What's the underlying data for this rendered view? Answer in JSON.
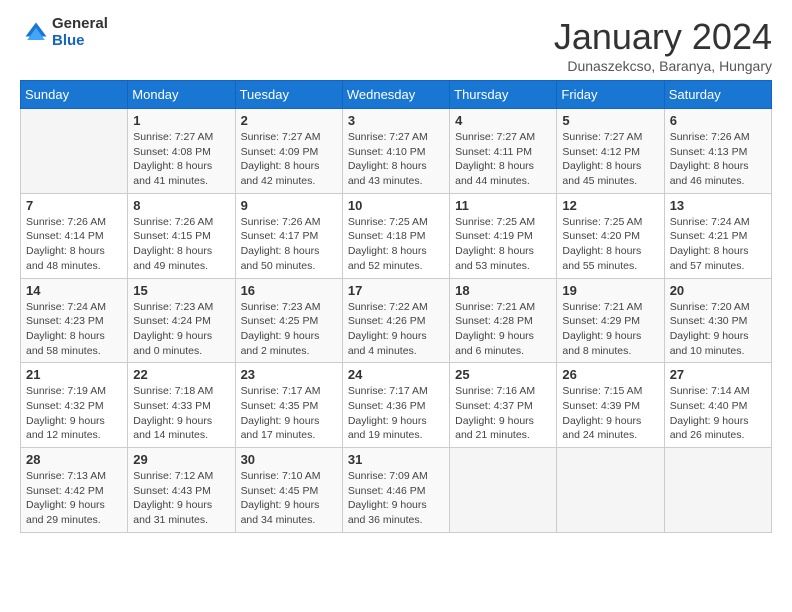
{
  "logo": {
    "general": "General",
    "blue": "Blue"
  },
  "header": {
    "title": "January 2024",
    "subtitle": "Dunaszekcso, Baranya, Hungary"
  },
  "days_of_week": [
    "Sunday",
    "Monday",
    "Tuesday",
    "Wednesday",
    "Thursday",
    "Friday",
    "Saturday"
  ],
  "weeks": [
    [
      {
        "day": "",
        "sunrise": "",
        "sunset": "",
        "daylight": ""
      },
      {
        "day": "1",
        "sunrise": "Sunrise: 7:27 AM",
        "sunset": "Sunset: 4:08 PM",
        "daylight": "Daylight: 8 hours and 41 minutes."
      },
      {
        "day": "2",
        "sunrise": "Sunrise: 7:27 AM",
        "sunset": "Sunset: 4:09 PM",
        "daylight": "Daylight: 8 hours and 42 minutes."
      },
      {
        "day": "3",
        "sunrise": "Sunrise: 7:27 AM",
        "sunset": "Sunset: 4:10 PM",
        "daylight": "Daylight: 8 hours and 43 minutes."
      },
      {
        "day": "4",
        "sunrise": "Sunrise: 7:27 AM",
        "sunset": "Sunset: 4:11 PM",
        "daylight": "Daylight: 8 hours and 44 minutes."
      },
      {
        "day": "5",
        "sunrise": "Sunrise: 7:27 AM",
        "sunset": "Sunset: 4:12 PM",
        "daylight": "Daylight: 8 hours and 45 minutes."
      },
      {
        "day": "6",
        "sunrise": "Sunrise: 7:26 AM",
        "sunset": "Sunset: 4:13 PM",
        "daylight": "Daylight: 8 hours and 46 minutes."
      }
    ],
    [
      {
        "day": "7",
        "sunrise": "Sunrise: 7:26 AM",
        "sunset": "Sunset: 4:14 PM",
        "daylight": "Daylight: 8 hours and 48 minutes."
      },
      {
        "day": "8",
        "sunrise": "Sunrise: 7:26 AM",
        "sunset": "Sunset: 4:15 PM",
        "daylight": "Daylight: 8 hours and 49 minutes."
      },
      {
        "day": "9",
        "sunrise": "Sunrise: 7:26 AM",
        "sunset": "Sunset: 4:17 PM",
        "daylight": "Daylight: 8 hours and 50 minutes."
      },
      {
        "day": "10",
        "sunrise": "Sunrise: 7:25 AM",
        "sunset": "Sunset: 4:18 PM",
        "daylight": "Daylight: 8 hours and 52 minutes."
      },
      {
        "day": "11",
        "sunrise": "Sunrise: 7:25 AM",
        "sunset": "Sunset: 4:19 PM",
        "daylight": "Daylight: 8 hours and 53 minutes."
      },
      {
        "day": "12",
        "sunrise": "Sunrise: 7:25 AM",
        "sunset": "Sunset: 4:20 PM",
        "daylight": "Daylight: 8 hours and 55 minutes."
      },
      {
        "day": "13",
        "sunrise": "Sunrise: 7:24 AM",
        "sunset": "Sunset: 4:21 PM",
        "daylight": "Daylight: 8 hours and 57 minutes."
      }
    ],
    [
      {
        "day": "14",
        "sunrise": "Sunrise: 7:24 AM",
        "sunset": "Sunset: 4:23 PM",
        "daylight": "Daylight: 8 hours and 58 minutes."
      },
      {
        "day": "15",
        "sunrise": "Sunrise: 7:23 AM",
        "sunset": "Sunset: 4:24 PM",
        "daylight": "Daylight: 9 hours and 0 minutes."
      },
      {
        "day": "16",
        "sunrise": "Sunrise: 7:23 AM",
        "sunset": "Sunset: 4:25 PM",
        "daylight": "Daylight: 9 hours and 2 minutes."
      },
      {
        "day": "17",
        "sunrise": "Sunrise: 7:22 AM",
        "sunset": "Sunset: 4:26 PM",
        "daylight": "Daylight: 9 hours and 4 minutes."
      },
      {
        "day": "18",
        "sunrise": "Sunrise: 7:21 AM",
        "sunset": "Sunset: 4:28 PM",
        "daylight": "Daylight: 9 hours and 6 minutes."
      },
      {
        "day": "19",
        "sunrise": "Sunrise: 7:21 AM",
        "sunset": "Sunset: 4:29 PM",
        "daylight": "Daylight: 9 hours and 8 minutes."
      },
      {
        "day": "20",
        "sunrise": "Sunrise: 7:20 AM",
        "sunset": "Sunset: 4:30 PM",
        "daylight": "Daylight: 9 hours and 10 minutes."
      }
    ],
    [
      {
        "day": "21",
        "sunrise": "Sunrise: 7:19 AM",
        "sunset": "Sunset: 4:32 PM",
        "daylight": "Daylight: 9 hours and 12 minutes."
      },
      {
        "day": "22",
        "sunrise": "Sunrise: 7:18 AM",
        "sunset": "Sunset: 4:33 PM",
        "daylight": "Daylight: 9 hours and 14 minutes."
      },
      {
        "day": "23",
        "sunrise": "Sunrise: 7:17 AM",
        "sunset": "Sunset: 4:35 PM",
        "daylight": "Daylight: 9 hours and 17 minutes."
      },
      {
        "day": "24",
        "sunrise": "Sunrise: 7:17 AM",
        "sunset": "Sunset: 4:36 PM",
        "daylight": "Daylight: 9 hours and 19 minutes."
      },
      {
        "day": "25",
        "sunrise": "Sunrise: 7:16 AM",
        "sunset": "Sunset: 4:37 PM",
        "daylight": "Daylight: 9 hours and 21 minutes."
      },
      {
        "day": "26",
        "sunrise": "Sunrise: 7:15 AM",
        "sunset": "Sunset: 4:39 PM",
        "daylight": "Daylight: 9 hours and 24 minutes."
      },
      {
        "day": "27",
        "sunrise": "Sunrise: 7:14 AM",
        "sunset": "Sunset: 4:40 PM",
        "daylight": "Daylight: 9 hours and 26 minutes."
      }
    ],
    [
      {
        "day": "28",
        "sunrise": "Sunrise: 7:13 AM",
        "sunset": "Sunset: 4:42 PM",
        "daylight": "Daylight: 9 hours and 29 minutes."
      },
      {
        "day": "29",
        "sunrise": "Sunrise: 7:12 AM",
        "sunset": "Sunset: 4:43 PM",
        "daylight": "Daylight: 9 hours and 31 minutes."
      },
      {
        "day": "30",
        "sunrise": "Sunrise: 7:10 AM",
        "sunset": "Sunset: 4:45 PM",
        "daylight": "Daylight: 9 hours and 34 minutes."
      },
      {
        "day": "31",
        "sunrise": "Sunrise: 7:09 AM",
        "sunset": "Sunset: 4:46 PM",
        "daylight": "Daylight: 9 hours and 36 minutes."
      },
      {
        "day": "",
        "sunrise": "",
        "sunset": "",
        "daylight": ""
      },
      {
        "day": "",
        "sunrise": "",
        "sunset": "",
        "daylight": ""
      },
      {
        "day": "",
        "sunrise": "",
        "sunset": "",
        "daylight": ""
      }
    ]
  ]
}
